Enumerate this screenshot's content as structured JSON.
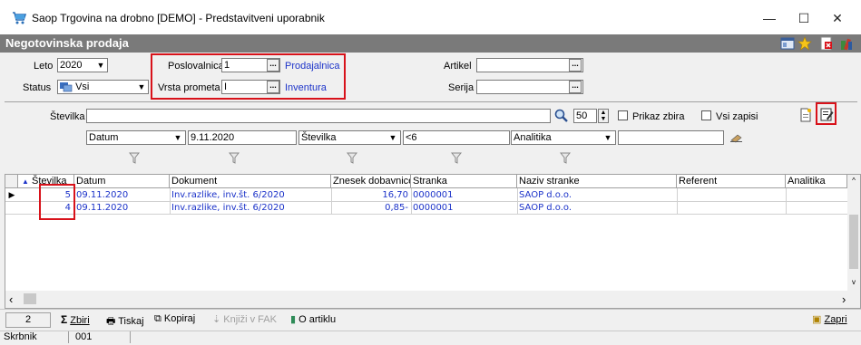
{
  "window": {
    "title": "Saop Trgovina na drobno [DEMO] - Predstavitveni uporabnik",
    "minimize": "—",
    "maximize": "☐",
    "close": "✕"
  },
  "form": {
    "title": "Negotovinska prodaja"
  },
  "filters": {
    "leto_label": "Leto",
    "leto_value": "2020",
    "status_label": "Status",
    "status_value": "Vsi",
    "poslovalnica_label": "Poslovalnica",
    "poslovalnica_value": "1",
    "poslovalnica_name": "Prodajalnica",
    "vrsta_label": "Vrsta prometa",
    "vrsta_value": "I",
    "vrsta_name": "Inventura",
    "artikel_label": "Artikel",
    "artikel_value": "",
    "serija_label": "Serija",
    "serija_value": ""
  },
  "search": {
    "stevilka_label": "Številka",
    "stevilka_value": "",
    "count": "50",
    "prikaz_zbira": "Prikaz zbira",
    "vsi_zapisi": "Vsi zapisi",
    "f1_field": "Datum",
    "f1_value": "9.11.2020",
    "f2_field": "Številka",
    "f2_value": "<6",
    "f3_field": "Analitika",
    "f3_value": ""
  },
  "table": {
    "columns": [
      "Številka",
      "Datum",
      "Dokument",
      "Znesek dobavnice",
      "Stranka",
      "Naziv stranke",
      "Referent",
      "Analitika"
    ],
    "rows": [
      {
        "stevilka": "5",
        "datum": "09.11.2020",
        "dokument": "Inv.razlike, inv.št. 6/2020",
        "znesek": "16,70",
        "stranka": "0000001",
        "naziv": "SAOP d.o.o.",
        "referent": "",
        "analitika": ""
      },
      {
        "stevilka": "4",
        "datum": "09.11.2020",
        "dokument": "Inv.razlike, inv.št. 6/2020",
        "znesek": "0,85-",
        "stranka": "0000001",
        "naziv": "SAOP d.o.o.",
        "referent": "",
        "analitika": ""
      }
    ]
  },
  "toolbar": {
    "count": "2",
    "zbiri": "Zbiri",
    "tiskaj": "Tiskaj",
    "kopiraj": "Kopiraj",
    "knjizi": "Knjiži v FAK",
    "o_artiklu": "O artiklu",
    "zapri": "Zapri"
  },
  "status": {
    "user": "Skrbnik",
    "code": "001"
  }
}
